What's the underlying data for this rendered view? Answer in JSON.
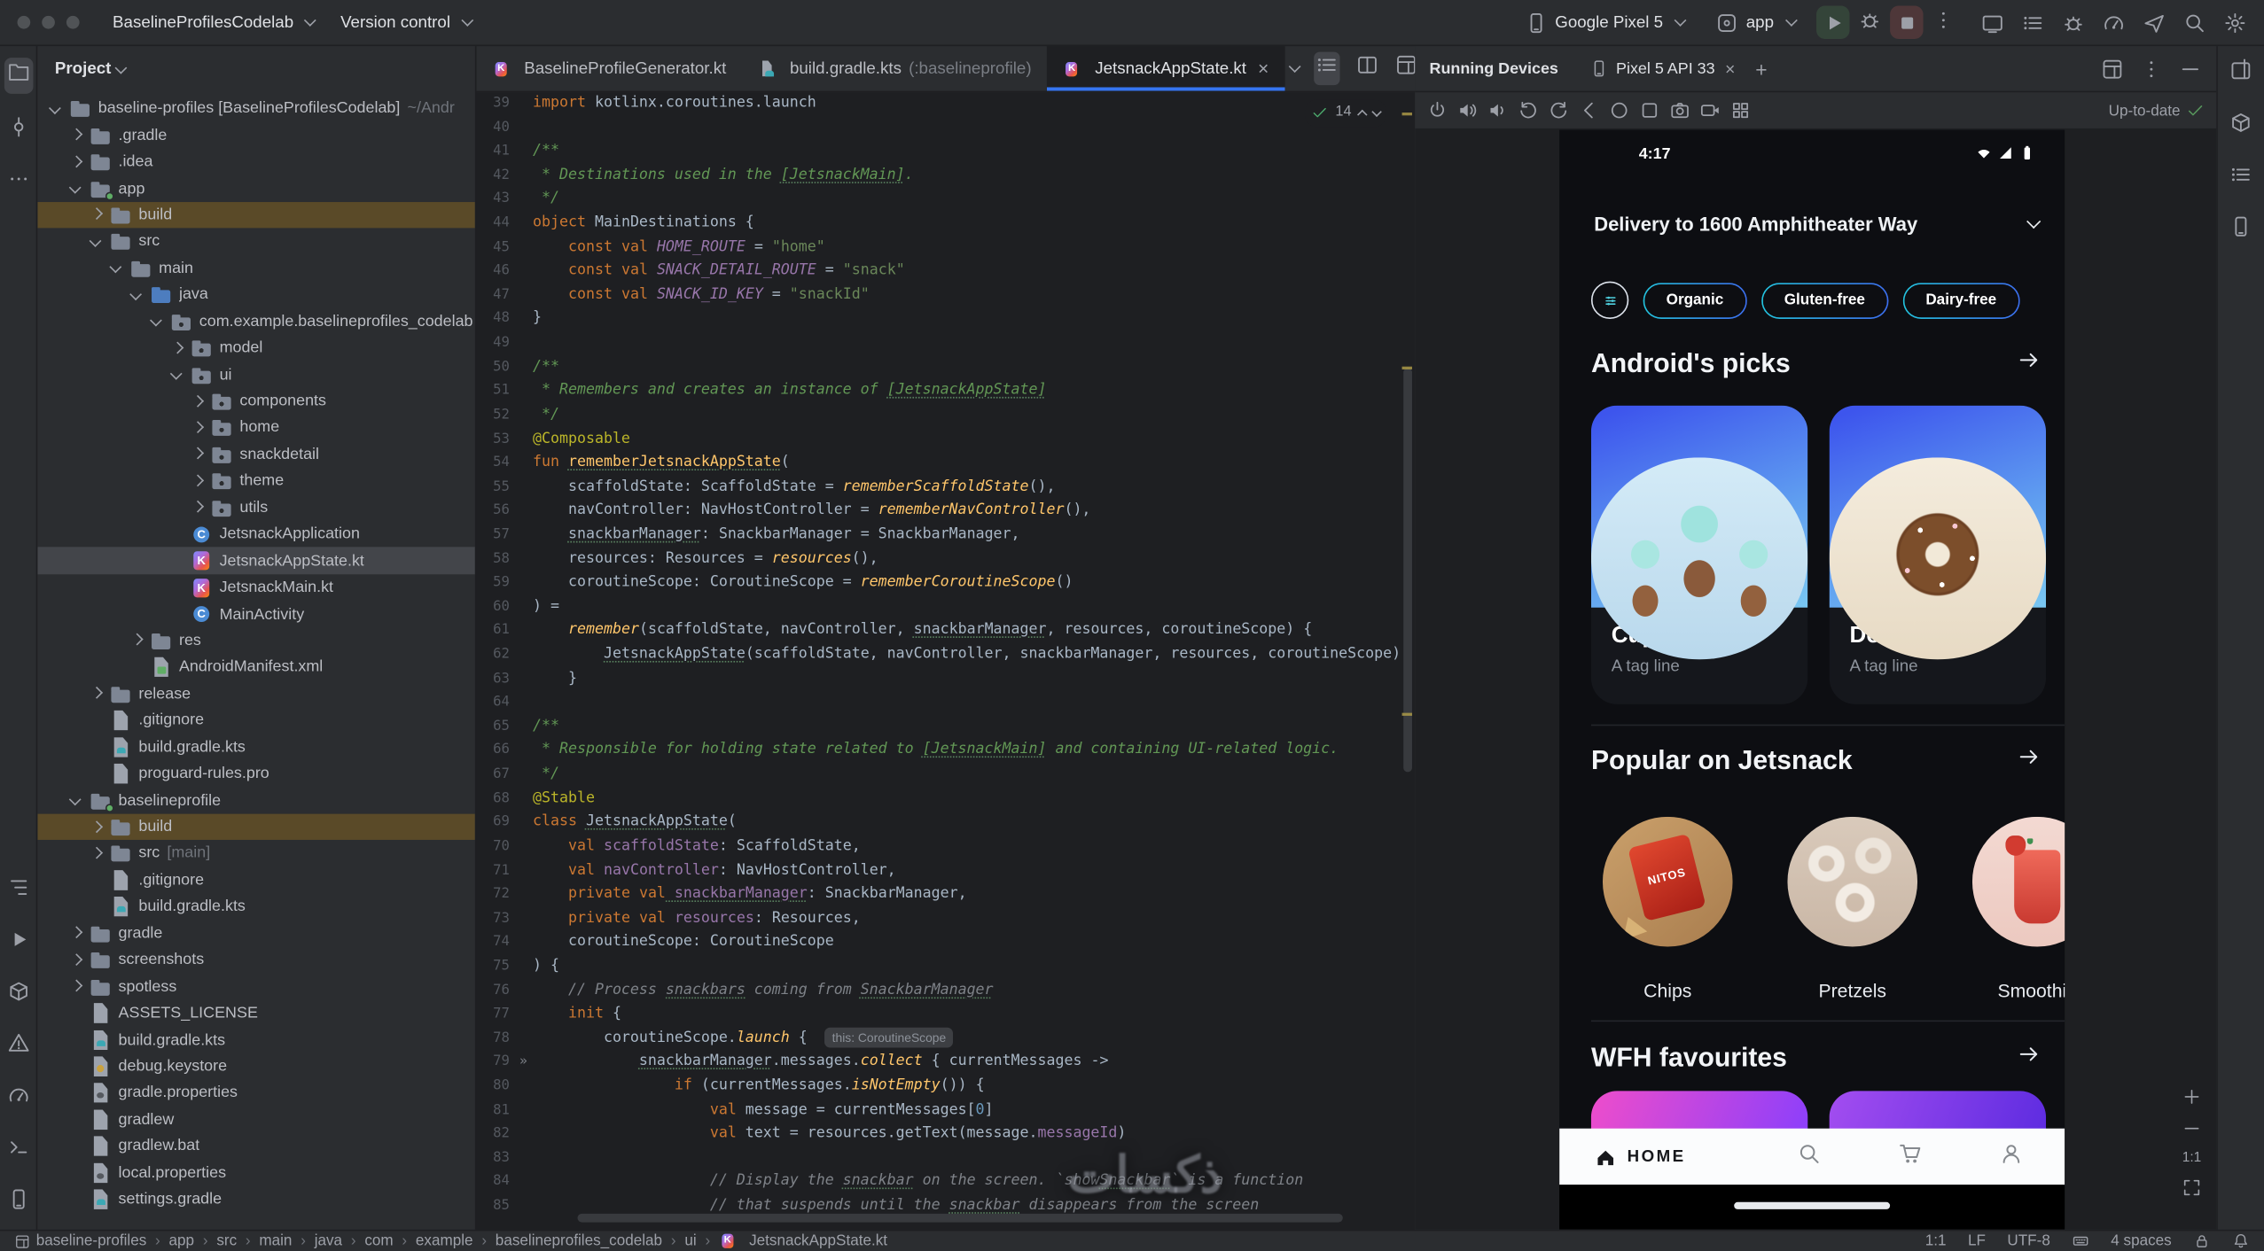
{
  "watermark": "ذكسات",
  "titlebar": {
    "project_name": "BaselineProfilesCodelab",
    "vcs_label": "Version control",
    "device_selector": "Google Pixel 5",
    "run_config": "app",
    "actions": [
      "cast",
      "list",
      "bug",
      "gauge",
      "send",
      "magnify",
      "gear"
    ],
    "accent": "#3574f0"
  },
  "tool_stripes": {
    "left_top": [
      "folder",
      "commit",
      "more"
    ],
    "left_bottom": [
      "struct",
      "play",
      "box",
      "warn",
      "gauge",
      "term",
      "phone"
    ],
    "right": [
      "panel",
      "box",
      "list",
      "phone"
    ]
  },
  "project_panel": {
    "title": "Project",
    "tree": [
      {
        "d": 0,
        "e": "o",
        "t": "folder",
        "l": "baseline-profiles [BaselineProfilesCodelab]",
        "h": "~/Andr"
      },
      {
        "d": 1,
        "e": "c",
        "t": "folder",
        "l": ".gradle"
      },
      {
        "d": 1,
        "e": "c",
        "t": "folder",
        "l": ".idea"
      },
      {
        "d": 1,
        "e": "o",
        "t": "module",
        "l": "app"
      },
      {
        "d": 2,
        "e": "c",
        "t": "folder",
        "l": "build",
        "warn": true
      },
      {
        "d": 2,
        "e": "o",
        "t": "folder",
        "l": "src"
      },
      {
        "d": 3,
        "e": "o",
        "t": "folder",
        "l": "main"
      },
      {
        "d": 4,
        "e": "o",
        "t": "srcroot",
        "l": "java"
      },
      {
        "d": 5,
        "e": "o",
        "t": "package",
        "l": "com.example.baselineprofiles_codelab"
      },
      {
        "d": 6,
        "e": "c",
        "t": "package",
        "l": "model"
      },
      {
        "d": 6,
        "e": "o",
        "t": "package",
        "l": "ui"
      },
      {
        "d": 7,
        "e": "c",
        "t": "package",
        "l": "components"
      },
      {
        "d": 7,
        "e": "c",
        "t": "package",
        "l": "home"
      },
      {
        "d": 7,
        "e": "c",
        "t": "package",
        "l": "snackdetail"
      },
      {
        "d": 7,
        "e": "c",
        "t": "package",
        "l": "theme"
      },
      {
        "d": 7,
        "e": "c",
        "t": "package",
        "l": "utils"
      },
      {
        "d": 6,
        "t": "kclass",
        "l": "JetsnackApplication"
      },
      {
        "d": 6,
        "t": "kotlin",
        "l": "JetsnackAppState.kt",
        "sel": true
      },
      {
        "d": 6,
        "t": "kotlin",
        "l": "JetsnackMain.kt"
      },
      {
        "d": 6,
        "t": "kclass",
        "l": "MainActivity"
      },
      {
        "d": 4,
        "e": "c",
        "t": "folder",
        "l": "res"
      },
      {
        "d": 4,
        "t": "manifest",
        "l": "AndroidManifest.xml"
      },
      {
        "d": 2,
        "e": "c",
        "t": "folder",
        "l": "release"
      },
      {
        "d": 2,
        "t": "file",
        "l": ".gitignore"
      },
      {
        "d": 2,
        "t": "gradle",
        "l": "build.gradle.kts"
      },
      {
        "d": 2,
        "t": "file",
        "l": "proguard-rules.pro"
      },
      {
        "d": 1,
        "e": "o",
        "t": "module",
        "l": "baselineprofile"
      },
      {
        "d": 2,
        "e": "c",
        "t": "folder",
        "l": "build",
        "warn": true
      },
      {
        "d": 2,
        "e": "c",
        "t": "folder",
        "l": "src",
        "h": "[main]"
      },
      {
        "d": 2,
        "t": "file",
        "l": ".gitignore"
      },
      {
        "d": 2,
        "t": "gradle",
        "l": "build.gradle.kts"
      },
      {
        "d": 1,
        "e": "c",
        "t": "folder",
        "l": "gradle"
      },
      {
        "d": 1,
        "e": "c",
        "t": "folder",
        "l": "screenshots"
      },
      {
        "d": 1,
        "e": "c",
        "t": "folder",
        "l": "spotless"
      },
      {
        "d": 1,
        "t": "file",
        "l": "ASSETS_LICENSE"
      },
      {
        "d": 1,
        "t": "gradle",
        "l": "build.gradle.kts"
      },
      {
        "d": 1,
        "t": "keystore",
        "l": "debug.keystore"
      },
      {
        "d": 1,
        "t": "props",
        "l": "gradle.properties"
      },
      {
        "d": 1,
        "t": "file",
        "l": "gradlew"
      },
      {
        "d": 1,
        "t": "file",
        "l": "gradlew.bat"
      },
      {
        "d": 1,
        "t": "props",
        "l": "local.properties"
      },
      {
        "d": 1,
        "t": "gradle",
        "l": "settings.gradle"
      }
    ]
  },
  "editor": {
    "tabs": [
      {
        "icon": "kotlin",
        "label": "BaselineProfileGenerator.kt",
        "active": false
      },
      {
        "icon": "gradle",
        "label": "build.gradle.kts",
        "hint": "(:baselineprofile)",
        "active": false
      },
      {
        "icon": "kotlin",
        "label": "JetsnackAppState.kt",
        "active": true,
        "close": true
      }
    ],
    "tab_actions": [
      "chevd",
      "list",
      "split",
      "float",
      "kebab"
    ],
    "inspections": {
      "count": "14"
    },
    "lines": [
      {
        "n": 39,
        "t": [
          [
            "k",
            "import"
          ],
          [
            "t",
            " kotlinx.coroutines.launch"
          ]
        ]
      },
      {
        "n": 40,
        "t": []
      },
      {
        "n": 41,
        "t": [
          [
            "d",
            "/**"
          ]
        ]
      },
      {
        "n": 42,
        "t": [
          [
            "d",
            " * Destinations used in the "
          ],
          [
            "d u",
            "[JetsnackMain]"
          ],
          [
            "d",
            "."
          ]
        ]
      },
      {
        "n": 43,
        "t": [
          [
            "d",
            " */"
          ]
        ]
      },
      {
        "n": 44,
        "t": [
          [
            "k",
            "object"
          ],
          [
            "t",
            " MainDestinations {"
          ]
        ]
      },
      {
        "n": 45,
        "t": [
          [
            "t",
            "    "
          ],
          [
            "k",
            "const"
          ],
          [
            "t",
            " "
          ],
          [
            "k",
            "val"
          ],
          [
            "pi",
            " HOME_ROUTE"
          ],
          [
            "t",
            " = "
          ],
          [
            "s",
            "\"home\""
          ]
        ]
      },
      {
        "n": 46,
        "t": [
          [
            "t",
            "    "
          ],
          [
            "k",
            "const"
          ],
          [
            "t",
            " "
          ],
          [
            "k",
            "val"
          ],
          [
            "pi",
            " SNACK_DETAIL_ROUTE"
          ],
          [
            "t",
            " = "
          ],
          [
            "s",
            "\"snack\""
          ]
        ]
      },
      {
        "n": 47,
        "t": [
          [
            "t",
            "    "
          ],
          [
            "k",
            "const"
          ],
          [
            "t",
            " "
          ],
          [
            "k",
            "val"
          ],
          [
            "pi",
            " SNACK_ID_KEY"
          ],
          [
            "t",
            " = "
          ],
          [
            "s",
            "\"snackId\""
          ]
        ]
      },
      {
        "n": 48,
        "t": [
          [
            "t",
            "}"
          ]
        ]
      },
      {
        "n": 49,
        "t": []
      },
      {
        "n": 50,
        "t": [
          [
            "d",
            "/**"
          ]
        ]
      },
      {
        "n": 51,
        "t": [
          [
            "d",
            " * Remembers and creates an instance of "
          ],
          [
            "d u",
            "[JetsnackAppState]"
          ]
        ]
      },
      {
        "n": 52,
        "t": [
          [
            "d",
            " */"
          ]
        ]
      },
      {
        "n": 53,
        "t": [
          [
            "a",
            "@Composable"
          ]
        ]
      },
      {
        "n": 54,
        "t": [
          [
            "k",
            "fun"
          ],
          [
            "t",
            " "
          ],
          [
            "f u",
            "rememberJetsnackAppState"
          ],
          [
            "t",
            "("
          ]
        ]
      },
      {
        "n": 55,
        "t": [
          [
            "t",
            "    scaffoldState: ScaffoldState = "
          ],
          [
            "i",
            "rememberScaffoldState"
          ],
          [
            "t",
            "(),"
          ]
        ]
      },
      {
        "n": 56,
        "t": [
          [
            "t",
            "    navController: NavHostController = "
          ],
          [
            "i",
            "rememberNavController"
          ],
          [
            "t",
            "(),"
          ]
        ]
      },
      {
        "n": 57,
        "t": [
          [
            "t",
            "    "
          ],
          [
            "t u",
            "snackbarManager"
          ],
          [
            "t",
            ": SnackbarManager = SnackbarManager,"
          ]
        ]
      },
      {
        "n": 58,
        "t": [
          [
            "t",
            "    resources: Resources = "
          ],
          [
            "i",
            "resources"
          ],
          [
            "t",
            "(),"
          ]
        ]
      },
      {
        "n": 59,
        "t": [
          [
            "t",
            "    coroutineScope: CoroutineScope = "
          ],
          [
            "i",
            "rememberCoroutineScope"
          ],
          [
            "t",
            "()"
          ]
        ]
      },
      {
        "n": 60,
        "t": [
          [
            "t",
            ") ="
          ]
        ]
      },
      {
        "n": 61,
        "t": [
          [
            "t",
            "    "
          ],
          [
            "i",
            "remember"
          ],
          [
            "t",
            "(scaffoldState, navController, "
          ],
          [
            "t u",
            "snackbarManager"
          ],
          [
            "t",
            ", resources, coroutineScope) {"
          ]
        ]
      },
      {
        "n": 62,
        "t": [
          [
            "t",
            "        "
          ],
          [
            "t u",
            "JetsnackAppState"
          ],
          [
            "t",
            "(scaffoldState, navController, snackbarManager, resources, coroutineScope)"
          ]
        ]
      },
      {
        "n": 63,
        "t": [
          [
            "t",
            "    }"
          ]
        ]
      },
      {
        "n": 64,
        "t": []
      },
      {
        "n": 65,
        "t": [
          [
            "d",
            "/**"
          ]
        ]
      },
      {
        "n": 66,
        "t": [
          [
            "d",
            " * Responsible for holding state related to "
          ],
          [
            "d u",
            "[JetsnackMain]"
          ],
          [
            "d",
            " and containing UI-related logic."
          ]
        ]
      },
      {
        "n": 67,
        "t": [
          [
            "d",
            " */"
          ]
        ]
      },
      {
        "n": 68,
        "t": [
          [
            "a",
            "@Stable"
          ]
        ]
      },
      {
        "n": 69,
        "t": [
          [
            "k",
            "class"
          ],
          [
            "t",
            " "
          ],
          [
            "t u",
            "JetsnackAppState"
          ],
          [
            "t",
            "("
          ]
        ]
      },
      {
        "n": 70,
        "t": [
          [
            "t",
            "    "
          ],
          [
            "k",
            "val"
          ],
          [
            "p",
            " scaffoldState"
          ],
          [
            "t",
            ": ScaffoldState,"
          ]
        ]
      },
      {
        "n": 71,
        "t": [
          [
            "t",
            "    "
          ],
          [
            "k",
            "val"
          ],
          [
            "p",
            " navController"
          ],
          [
            "t",
            ": NavHostController,"
          ]
        ]
      },
      {
        "n": 72,
        "t": [
          [
            "t",
            "    "
          ],
          [
            "k",
            "private"
          ],
          [
            "t",
            " "
          ],
          [
            "k",
            "val"
          ],
          [
            "p u",
            " snackbarManager"
          ],
          [
            "t",
            ": SnackbarManager,"
          ]
        ]
      },
      {
        "n": 73,
        "t": [
          [
            "t",
            "    "
          ],
          [
            "k",
            "private"
          ],
          [
            "t",
            " "
          ],
          [
            "k",
            "val"
          ],
          [
            "p",
            " resources"
          ],
          [
            "t",
            ": Resources,"
          ]
        ]
      },
      {
        "n": 74,
        "t": [
          [
            "t",
            "    coroutineScope: CoroutineScope"
          ]
        ]
      },
      {
        "n": 75,
        "t": [
          [
            "t",
            ") {"
          ]
        ]
      },
      {
        "n": 76,
        "t": [
          [
            "c",
            "    // Process "
          ],
          [
            "c u",
            "snackbars"
          ],
          [
            "c",
            " coming from "
          ],
          [
            "c u",
            "SnackbarManager"
          ]
        ]
      },
      {
        "n": 77,
        "t": [
          [
            "t",
            "    "
          ],
          [
            "k",
            "init"
          ],
          [
            "t",
            " {"
          ]
        ]
      },
      {
        "n": 78,
        "t": [
          [
            "t",
            "        coroutineScope."
          ],
          [
            "i",
            "launch"
          ],
          [
            "t",
            " { "
          ],
          [
            "h",
            "this: CoroutineScope"
          ]
        ]
      },
      {
        "n": 79,
        "g": true,
        "t": [
          [
            "t",
            "            "
          ],
          [
            "t u",
            "snackbarManager"
          ],
          [
            "t",
            ".messages."
          ],
          [
            "i",
            "collect"
          ],
          [
            "t",
            " { currentMessages ->"
          ]
        ]
      },
      {
        "n": 80,
        "t": [
          [
            "t",
            "                "
          ],
          [
            "k",
            "if"
          ],
          [
            "t",
            " (currentMessages."
          ],
          [
            "i",
            "isNotEmpty"
          ],
          [
            "t",
            "()) {"
          ]
        ]
      },
      {
        "n": 81,
        "t": [
          [
            "t",
            "                    "
          ],
          [
            "k",
            "val"
          ],
          [
            "t",
            " message = currentMessages["
          ],
          [
            "n2",
            "0"
          ],
          [
            "t",
            "]"
          ]
        ]
      },
      {
        "n": 82,
        "t": [
          [
            "t",
            "                    "
          ],
          [
            "k",
            "val"
          ],
          [
            "t",
            " text = resources.getText(message."
          ],
          [
            "p",
            "messageId"
          ],
          [
            "t",
            ")"
          ]
        ]
      },
      {
        "n": 83,
        "t": []
      },
      {
        "n": 84,
        "t": [
          [
            "c",
            "                    // Display the "
          ],
          [
            "c u",
            "snackbar"
          ],
          [
            "c",
            " on the screen. `show"
          ],
          [
            "c u",
            "Snackbar"
          ],
          [
            "c",
            "` is a function"
          ]
        ]
      },
      {
        "n": 85,
        "t": [
          [
            "c",
            "                    // that suspends until the "
          ],
          [
            "c u",
            "snackbar"
          ],
          [
            "c",
            " disappears from the screen"
          ]
        ]
      }
    ]
  },
  "devices_panel": {
    "title": "Running Devices",
    "tab_label": "Pixel 5 API 33",
    "header_actions": [
      "float",
      "kebab",
      "dash"
    ],
    "toolbar_icons": [
      "power",
      "vol",
      "vol2",
      "rotl",
      "rotr",
      "back",
      "circle",
      "square",
      "camera",
      "video",
      "grid"
    ],
    "status": "Up-to-date",
    "zoom_label": "1:1"
  },
  "phone": {
    "time": "4:17",
    "delivery": "Delivery to 1600 Amphitheater Way",
    "filters": [
      "Organic",
      "Gluten-free",
      "Dairy-free"
    ],
    "sections": {
      "picks": {
        "title": "Android's picks",
        "cards": [
          {
            "name": "Cupcake",
            "tag": "A tag line",
            "art": "cupcake"
          },
          {
            "name": "Donut",
            "tag": "A tag line",
            "art": "donut"
          }
        ]
      },
      "popular": {
        "title": "Popular on Jetsnack",
        "items": [
          {
            "name": "Chips",
            "art": "chips"
          },
          {
            "name": "Pretzels",
            "art": "pretzels"
          },
          {
            "name": "Smoothie",
            "art": "smoothie"
          }
        ]
      },
      "wfh": {
        "title": "WFH favourites"
      }
    },
    "nav": {
      "home_label": "HOME",
      "icons": [
        "magnify",
        "cart",
        "person"
      ]
    }
  },
  "status_bar": {
    "project": "baseline-profiles",
    "breadcrumbs": [
      "app",
      "src",
      "main",
      "java",
      "com",
      "example",
      "baselineprofiles_codelab",
      "ui"
    ],
    "file": "JetsnackAppState.kt",
    "right_items": [
      {
        "t": "1:1"
      },
      {
        "t": "LF"
      },
      {
        "t": "UTF-8"
      },
      {
        "i": "kb"
      },
      {
        "t": "4 spaces"
      },
      {
        "i": "lock"
      },
      {
        "i": "bell"
      }
    ]
  }
}
